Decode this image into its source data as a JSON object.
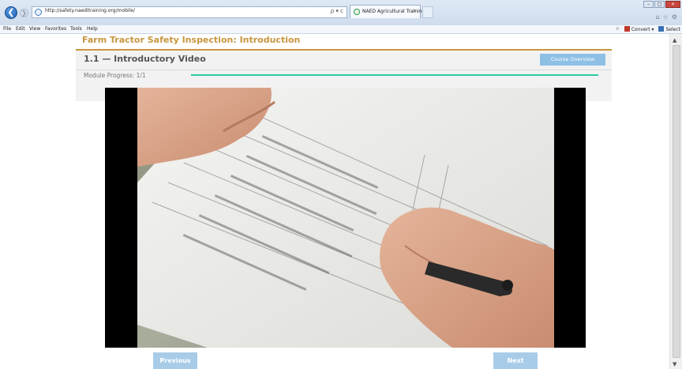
{
  "browser": {
    "address_text": "http://safety.naeditraining.org/mobile/",
    "tab_title": "NAED Agricultural Training...",
    "search_label": "ρ ▾ c",
    "menu": [
      "File",
      "Edit",
      "View",
      "Favorites",
      "Tools",
      "Help"
    ],
    "convert_label": "Convert",
    "select_label": "Select"
  },
  "page": {
    "course_title": "Farm Tractor Safety Inspection: Introduction",
    "module_title": "1.1 — Introductory Video",
    "course_overview_label": "Course Overview",
    "progress_label": "Module Progress: 1/1",
    "progress_fraction": 1.0,
    "previous_label": "Previous",
    "next_label": "Next"
  },
  "colors": {
    "accent_gold": "#c8963e",
    "progress_teal": "#2ec9a3",
    "button_blue": "#a8cce8"
  }
}
